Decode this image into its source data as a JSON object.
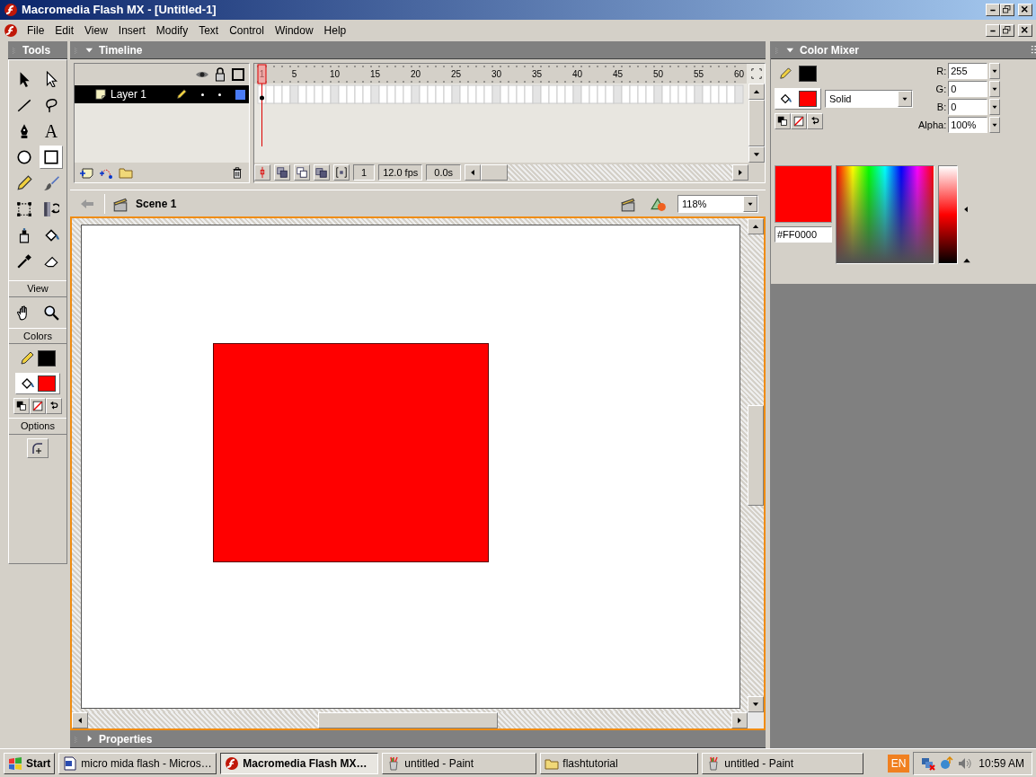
{
  "window": {
    "title": "Macromedia Flash MX - [Untitled-1]"
  },
  "menu": [
    "File",
    "Edit",
    "View",
    "Insert",
    "Modify",
    "Text",
    "Control",
    "Window",
    "Help"
  ],
  "tools_panel": {
    "title": "Tools",
    "tools": [
      {
        "kind": "arrow",
        "selected": false
      },
      {
        "kind": "subselect",
        "selected": false
      },
      {
        "kind": "line",
        "selected": false
      },
      {
        "kind": "lasso",
        "selected": false
      },
      {
        "kind": "pen",
        "selected": false
      },
      {
        "kind": "text",
        "glyph": "A",
        "selected": false
      },
      {
        "kind": "oval",
        "selected": false
      },
      {
        "kind": "rectangle",
        "selected": true
      },
      {
        "kind": "pencil",
        "selected": false
      },
      {
        "kind": "brush",
        "selected": false
      },
      {
        "kind": "free-transform",
        "selected": false
      },
      {
        "kind": "fill-transform",
        "selected": false
      },
      {
        "kind": "ink-bottle",
        "selected": false
      },
      {
        "kind": "paint-bucket",
        "selected": false
      },
      {
        "kind": "eyedropper",
        "selected": false
      },
      {
        "kind": "eraser",
        "selected": false
      }
    ],
    "view_label": "View",
    "view_tools": [
      {
        "kind": "hand",
        "selected": false
      },
      {
        "kind": "zoom",
        "selected": false
      }
    ],
    "colors_label": "Colors",
    "colors": [
      {
        "kind": "stroke",
        "color": "#000000",
        "selected": false
      },
      {
        "kind": "fill",
        "color": "#ff0000",
        "selected": true
      }
    ],
    "options_label": "Options"
  },
  "timeline": {
    "title": "Timeline",
    "expanded": true,
    "layers": [
      {
        "name": "Layer 1",
        "selected": true,
        "color": "#4a7cf7"
      }
    ],
    "ruler_labels": [
      "1",
      "5",
      "10",
      "15",
      "20",
      "25",
      "30",
      "35",
      "40",
      "45",
      "50",
      "55",
      "60"
    ],
    "current_frame": "1",
    "frame_rate": "12.0 fps",
    "elapsed": "0.0s"
  },
  "edit_bar": {
    "scene": "Scene 1",
    "zoom": "118%"
  },
  "properties": {
    "title": "Properties",
    "expanded": false
  },
  "color_mixer": {
    "title": "Color Mixer",
    "expanded": true,
    "swatches": [
      {
        "kind": "stroke",
        "color": "#000000",
        "selected": false
      },
      {
        "kind": "fill",
        "color": "#ff0000",
        "selected": true
      }
    ],
    "fill_type": "Solid",
    "channels": [
      {
        "label": "R:",
        "value": "255"
      },
      {
        "label": "G:",
        "value": "0"
      },
      {
        "label": "B:",
        "value": "0"
      },
      {
        "label": "Alpha:",
        "value": "100%"
      }
    ],
    "hex": "#FF0000"
  },
  "taskbar": {
    "start": "Start",
    "tasks": [
      {
        "kind": "document",
        "label": "micro mida flash - Micros…",
        "selected": false
      },
      {
        "kind": "flash",
        "label": "Macromedia Flash MX…",
        "selected": true
      },
      {
        "kind": "paint",
        "label": "untitled - Paint",
        "selected": false
      },
      {
        "kind": "folder",
        "label": "flashtutorial",
        "selected": false
      },
      {
        "kind": "paint",
        "label": "untitled - Paint",
        "selected": false
      }
    ],
    "language": "EN",
    "clock": "10:59 AM"
  }
}
